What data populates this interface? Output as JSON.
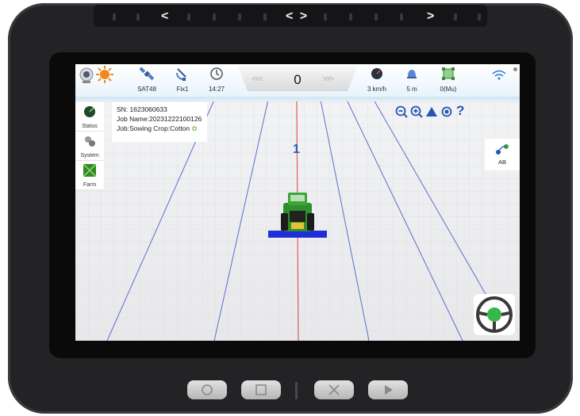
{
  "status_bar": {
    "satellites": "SAT48",
    "fix": "Fix1",
    "time": "14:27",
    "speed_value": "0",
    "left_chevrons": "<<<",
    "right_chevrons": ">>>",
    "ground_speed": "3 km/h",
    "line_spacing": "5 m",
    "area": "0(Mu)"
  },
  "sidebar": {
    "items": [
      {
        "label": "Status",
        "icon": "radar-icon"
      },
      {
        "label": "System",
        "icon": "gears-icon"
      },
      {
        "label": "Farm",
        "icon": "farm-field-icon"
      }
    ]
  },
  "job_info": {
    "sn": "SN: 1623060633",
    "job_name": "Job Name:20231222100126",
    "job_crop": "Job:Sowing  Crop:Cotton"
  },
  "map": {
    "line_number": "1",
    "guideline_color": "#5b6ed1",
    "center_line_color": "#e05a5a",
    "implement_color": "#1f2fd8"
  },
  "controls": {
    "ab_label": "AB"
  },
  "device": {
    "top_arrows": [
      "<",
      "< >",
      ">"
    ],
    "hardware_buttons": [
      "circle-button-icon",
      "square-button-icon",
      "x-button-icon",
      "play-button-icon"
    ]
  }
}
